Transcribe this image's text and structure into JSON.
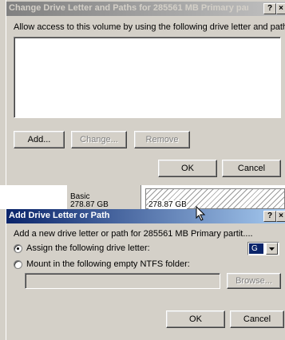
{
  "dialog1": {
    "title": "Change Drive Letter and Paths for 285561 MB  Primary par...",
    "instruction": "Allow access to this volume by using the following drive letter and paths:",
    "add_label": "Add...",
    "change_label": "Change...",
    "remove_label": "Remove",
    "ok_label": "OK",
    "cancel_label": "Cancel"
  },
  "background": {
    "disk_label": "Basic",
    "disk_size": "278.87 GB",
    "partition_size": "278.87 GB"
  },
  "dialog2": {
    "title": "Add Drive Letter or Path",
    "intro": "Add a new drive letter or path for 285561 MB  Primary partit....",
    "option_assign": "Assign the following drive letter:",
    "option_mount": "Mount in the following empty NTFS folder:",
    "drive_letter": "G",
    "browse_label": "Browse...",
    "ok_label": "OK",
    "cancel_label": "Cancel",
    "selected_option": "assign"
  },
  "titlebar_help": "?",
  "titlebar_close": "×",
  "colors": {
    "dialog_bg": "#d4d0c8",
    "active_title_start": "#0a246a",
    "active_title_end": "#a6caf0",
    "inactive_title_start": "#808080",
    "inactive_title_end": "#c0c0c0"
  }
}
